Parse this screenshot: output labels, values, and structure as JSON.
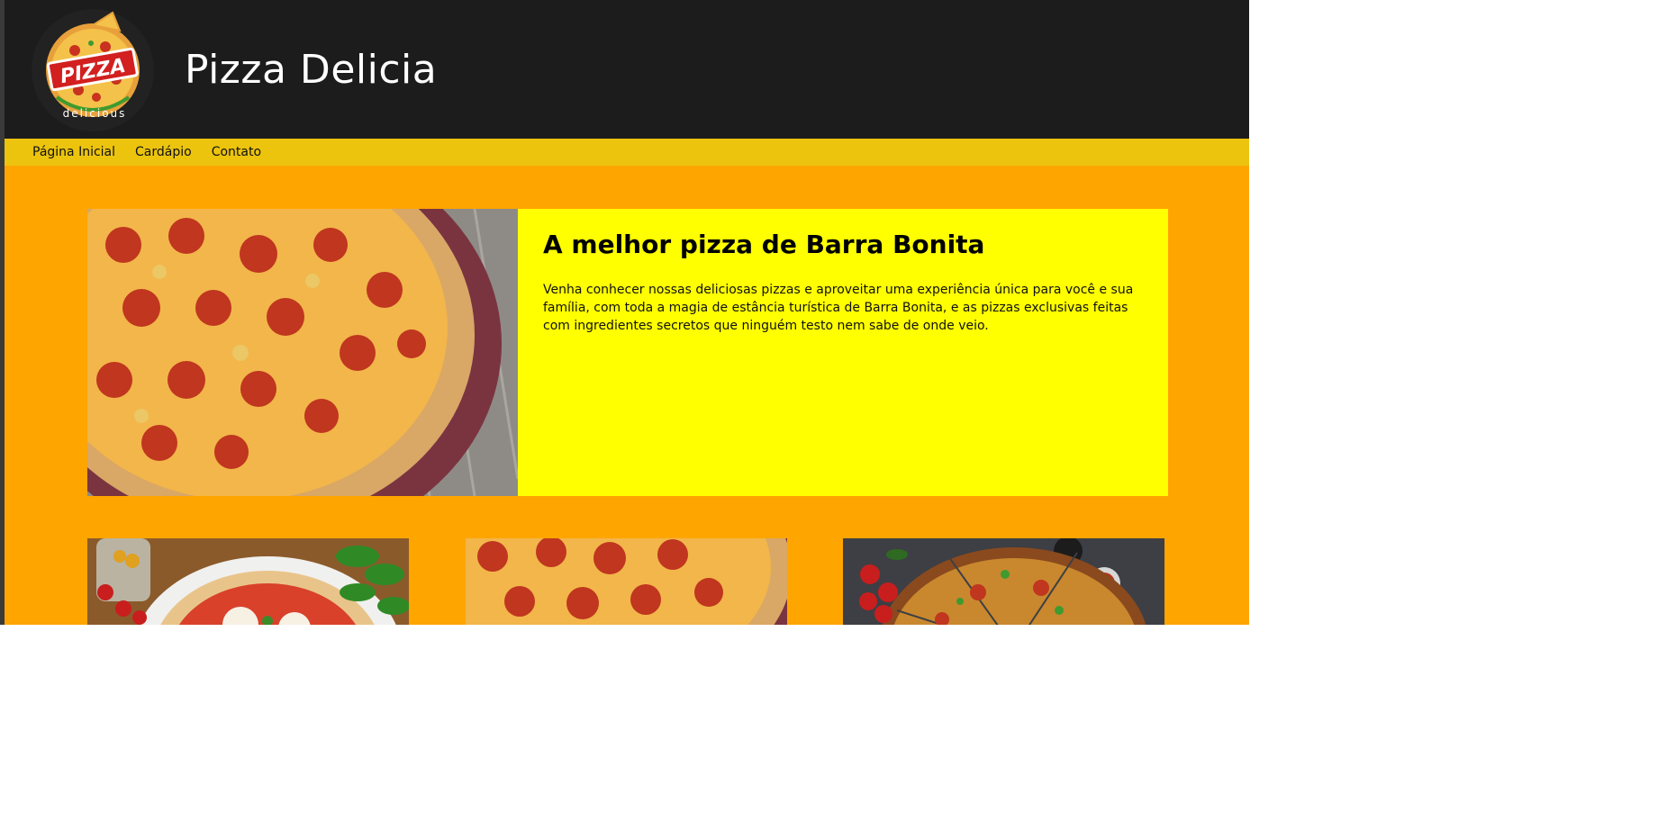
{
  "header": {
    "logo": {
      "icon": "pizza-logo-icon",
      "text_top": "PIZZA",
      "text_bottom": "delicious"
    },
    "title": "Pizza Delicia"
  },
  "nav": {
    "items": [
      {
        "label": "Página Inicial"
      },
      {
        "label": "Cardápio"
      },
      {
        "label": "Contato"
      }
    ]
  },
  "hero": {
    "image": "pepperoni-pizza-image",
    "title": "A melhor pizza de Barra Bonita",
    "description": "Venha conhecer nossas deliciosas pizzas e aproveitar uma experiência única para você e sua família, com toda a magia de estância turística de Barra Bonita, e as pizzas exclusivas feitas com ingredientes secretos que ninguém testo nem sabe de onde veio."
  },
  "gallery": {
    "items": [
      {
        "image": "margherita-pizza-image"
      },
      {
        "image": "pepperoni-pizza-image"
      },
      {
        "image": "supreme-pizza-image"
      }
    ]
  },
  "colors": {
    "header_bg": "#1c1c1c",
    "nav_bg": "#ecc40e",
    "page_bg": "#ffa500",
    "hero_text_bg": "#ffff00"
  }
}
